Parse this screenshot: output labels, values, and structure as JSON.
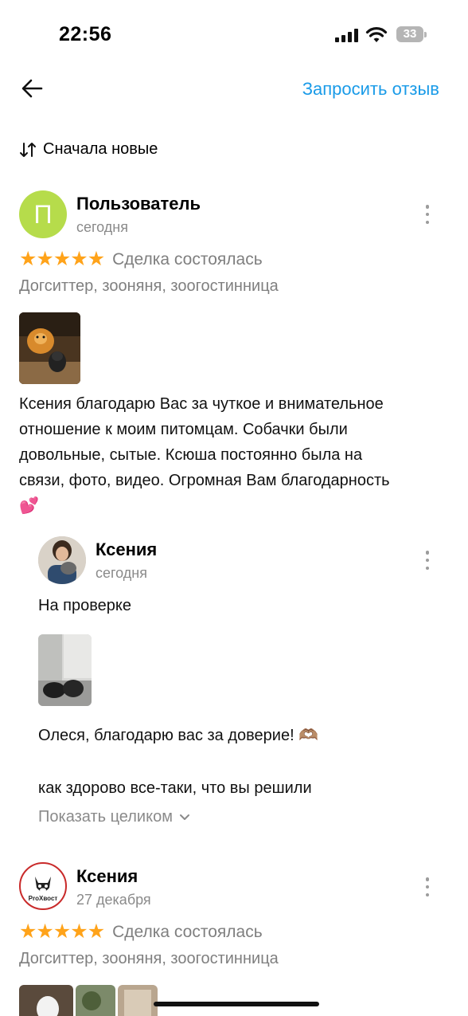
{
  "status_bar": {
    "time": "22:56",
    "battery": "33"
  },
  "header": {
    "request_label": "Запросить отзыв"
  },
  "sort": {
    "label": "Сначала новые"
  },
  "reviews": [
    {
      "author": "Пользователь",
      "avatar_letter": "П",
      "avatar_color": "#b6dc4b",
      "date": "сегодня",
      "rating": 5,
      "status": "Сделка состоялась",
      "category": "Догситтер, зооняня, зоогостинница",
      "text_lines": [
        "Ксения благодарю Вас за чуткое и внимательное",
        "отношение к моим питомцам. Собачки были",
        "довольные, сытые. Ксюша постоянно была на",
        "связи, фото, видео. Огромная Вам благодарность",
        "💕"
      ],
      "reply": {
        "author": "Ксения",
        "date": "сегодня",
        "status": "На проверке",
        "text_line1": "Олеся, благодарю вас за доверие! 🫶🏽",
        "text_line2": "как здорово все-таки, что вы решили",
        "show_full": "Показать целиком"
      }
    },
    {
      "author": "Ксения",
      "date": "27 декабря",
      "rating": 5,
      "status": "Сделка состоялась",
      "category": "Догситтер, зооняня, зоогостинница",
      "logo_text": "ProХвост"
    }
  ],
  "colors": {
    "accent": "#1a9be8",
    "star": "#ffa31a"
  }
}
